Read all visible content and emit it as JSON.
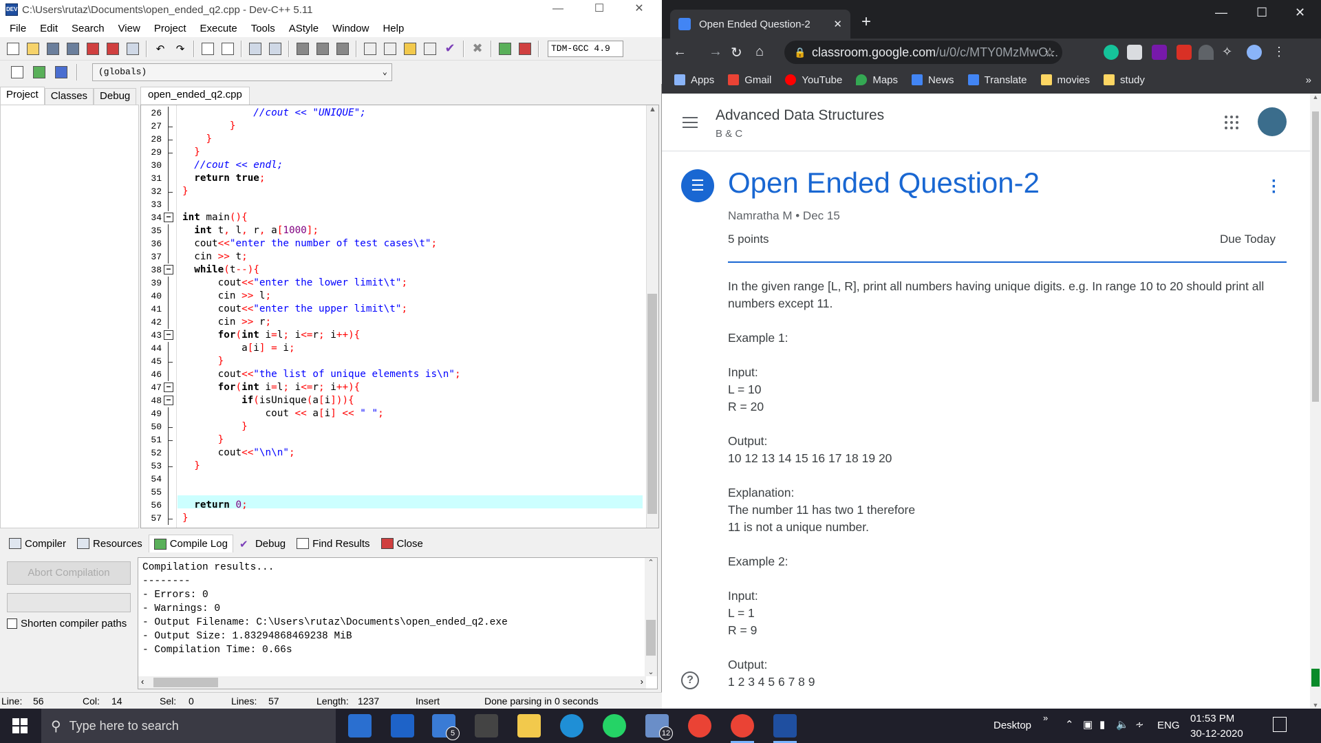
{
  "devcpp": {
    "title": "C:\\Users\\rutaz\\Documents\\open_ended_q2.cpp - Dev-C++ 5.11",
    "menu": [
      "File",
      "Edit",
      "Search",
      "View",
      "Project",
      "Execute",
      "Tools",
      "AStyle",
      "Window",
      "Help"
    ],
    "compiler_select": "TDM-GCC 4.9",
    "scope_select": "(globals)",
    "left_tabs": [
      "Project",
      "Classes",
      "Debug"
    ],
    "file_tab": "open_ended_q2.cpp",
    "bottom_tabs": [
      "Compiler",
      "Resources",
      "Compile Log",
      "Debug",
      "Find Results",
      "Close"
    ],
    "abort_button": "Abort Compilation",
    "shorten_label": "Shorten compiler paths",
    "compile_log": "Compilation results...\n--------\n- Errors: 0\n- Warnings: 0\n- Output Filename: C:\\Users\\rutaz\\Documents\\open_ended_q2.exe\n- Output Size: 1.83294868469238 MiB\n- Compilation Time: 0.66s",
    "status": {
      "line_label": "Line:",
      "line": "56",
      "col_label": "Col:",
      "col": "14",
      "sel_label": "Sel:",
      "sel": "0",
      "lines_label": "Lines:",
      "lines": "57",
      "length_label": "Length:",
      "length": "1237",
      "mode": "Insert",
      "parse": "Done parsing in 0 seconds"
    },
    "line_numbers": [
      "26",
      "27",
      "28",
      "29",
      "30",
      "31",
      "32",
      "33",
      "34",
      "35",
      "36",
      "37",
      "38",
      "39",
      "40",
      "41",
      "42",
      "43",
      "44",
      "45",
      "46",
      "47",
      "48",
      "49",
      "50",
      "51",
      "52",
      "53",
      "54",
      "55",
      "56",
      "57"
    ],
    "code_lines": [
      "            //cout << \"UNIQUE\";",
      "        }",
      "    }",
      "  }",
      "  //cout << endl;",
      "  return true;",
      "}",
      "",
      "int main(){",
      "  int t, l, r, a[1000];",
      "  cout<<\"enter the number of test cases\\t\";",
      "  cin >> t;",
      "  while(t--){",
      "      cout<<\"enter the lower limit\\t\";",
      "      cin >> l;",
      "      cout<<\"enter the upper limit\\t\";",
      "      cin >> r;",
      "      for(int i=l; i<=r; i++){",
      "          a[i] = i;",
      "      }",
      "      cout<<\"the list of unique elements is\\n\";",
      "      for(int i=l; i<=r; i++){",
      "          if(isUnique(a[i])){",
      "              cout << a[i] << \" \";",
      "          }",
      "      }",
      "      cout<<\"\\n\\n\";",
      "  }",
      "",
      "",
      "  return 0;",
      "}"
    ]
  },
  "chrome": {
    "tab_title": "Open Ended Question-2",
    "url_host": "classroom.google.com",
    "url_path": "/u/0/c/MTY0MzMwO...",
    "bookmarks": [
      "Apps",
      "Gmail",
      "YouTube",
      "Maps",
      "News",
      "Translate",
      "movies",
      "study"
    ],
    "bookmarks_more": "»"
  },
  "classroom": {
    "course_name": "Advanced Data Structures",
    "course_section": "B & C",
    "assignment_title": "Open Ended Question-2",
    "meta": "Namratha M • Dec 15",
    "points": "5 points",
    "due": "Due Today",
    "description": [
      "In the given range [L, R], print all numbers having unique digits. e.g. In range 10 to 20 should print all numbers except 11.",
      "",
      "Example 1:",
      "",
      "Input:",
      "L = 10",
      "R = 20",
      "",
      "Output:",
      "10 12 13 14 15 16 17 18 19 20",
      "",
      "Explanation:",
      "The number 11 has two 1 therefore",
      "11 is not a unique number.",
      "",
      "Example 2:",
      "",
      "Input:",
      "L = 1",
      "R = 9",
      "",
      "Output:",
      "1 2 3 4 5 6 7 8 9"
    ]
  },
  "taskbar": {
    "search_placeholder": "Type here to search",
    "mail_badge": "5",
    "app12_badge": "12",
    "desktop_label": "Desktop",
    "chevron": "»",
    "lang": "ENG",
    "time": "01:53 PM",
    "date": "30-12-2020"
  },
  "colors": {
    "accent": "#1967d2",
    "editor_highlight": "#ccffff",
    "taskbar": "#1f1f2a"
  }
}
